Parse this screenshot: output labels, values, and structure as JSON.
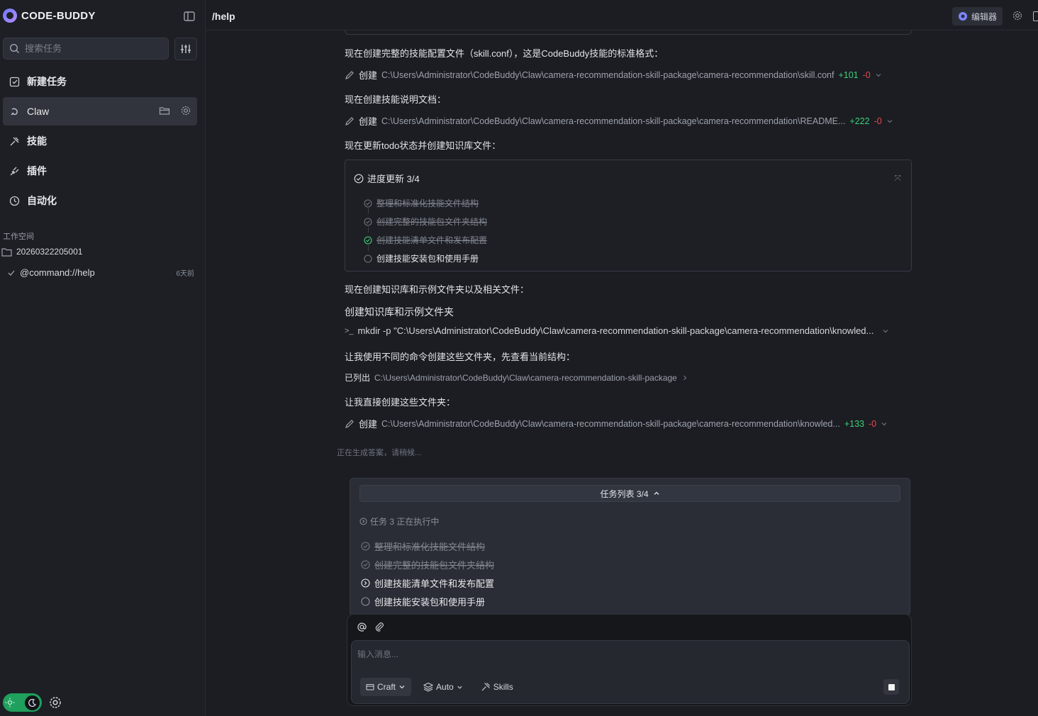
{
  "app": {
    "brand": "CODE-BUDDY",
    "accent_color": "#1fa05c",
    "brand_gradient": [
      "#6c7bff",
      "#b58cff"
    ]
  },
  "sidebar": {
    "search_placeholder": "搜索任务",
    "items": [
      {
        "label": "新建任务",
        "icon": "edit-square-icon"
      },
      {
        "label": "Claw",
        "icon": "claw-icon",
        "active": true
      },
      {
        "label": "技能",
        "icon": "skill-icon"
      },
      {
        "label": "插件",
        "icon": "plug-icon"
      },
      {
        "label": "自动化",
        "icon": "clock-icon"
      }
    ],
    "workspace_title": "工作空间",
    "workspace_folder": "20260322205001",
    "workspace_task": {
      "title": "@command://help",
      "time": "6天前"
    }
  },
  "topbar": {
    "path": "/help",
    "editor_label": "编辑器"
  },
  "conversation": {
    "messages": [
      {
        "type": "text",
        "text": "现在创建完整的技能配置文件（skill.conf），这是CodeBuddy技能的标准格式："
      },
      {
        "type": "tool",
        "verb": "创建",
        "path": "C:\\Users\\Administrator\\CodeBuddy\\Claw\\camera-recommendation-skill-package\\camera-recommendation\\skill.conf",
        "plus": "+101",
        "minus": "-0"
      },
      {
        "type": "text",
        "text": "现在创建技能说明文档："
      },
      {
        "type": "tool",
        "verb": "创建",
        "path": "C:\\Users\\Administrator\\CodeBuddy\\Claw\\camera-recommendation-skill-package\\camera-recommendation\\README...",
        "plus": "+222",
        "minus": "-0"
      },
      {
        "type": "text",
        "text": "现在更新todo状态并创建知识库文件："
      },
      {
        "type": "text",
        "text": "现在创建知识库和示例文件夹以及相关文件："
      },
      {
        "type": "text",
        "text": "创建知识库和示例文件夹"
      },
      {
        "type": "command",
        "prompt": ">_",
        "text": "mkdir -p \"C:\\Users\\Administrator\\CodeBuddy\\Claw\\camera-recommendation-skill-package\\camera-recommendation\\knowled..."
      },
      {
        "type": "text",
        "text": "让我使用不同的命令创建这些文件夹，先查看当前结构："
      },
      {
        "type": "list",
        "verb": "已列出",
        "path": "C:\\Users\\Administrator\\CodeBuddy\\Claw\\camera-recommendation-skill-package"
      },
      {
        "type": "text",
        "text": "让我直接创建这些文件夹："
      },
      {
        "type": "tool",
        "verb": "创建",
        "path": "C:\\Users\\Administrator\\CodeBuddy\\Claw\\camera-recommendation-skill-package\\camera-recommendation\\knowled...",
        "plus": "+133",
        "minus": "-0"
      }
    ],
    "progress": {
      "title": "进度更新 3/4",
      "todos": [
        {
          "text": "整理和标准化技能文件结构",
          "status": "done"
        },
        {
          "text": "创建完整的技能包文件夹结构",
          "status": "done"
        },
        {
          "text": "创建技能清单文件和发布配置",
          "status": "done"
        },
        {
          "text": "创建技能安装包和使用手册",
          "status": "pending"
        }
      ]
    },
    "generating_text": "正在生成答案，请稍候..."
  },
  "task_panel": {
    "header": "任务列表 3/4",
    "running": "任务 3 正在执行中",
    "todos": [
      {
        "text": "整理和标准化技能文件结构",
        "status": "done"
      },
      {
        "text": "创建完整的技能包文件夹结构",
        "status": "done"
      },
      {
        "text": "创建技能清单文件和发布配置",
        "status": "running"
      },
      {
        "text": "创建技能安装包和使用手册",
        "status": "pending"
      }
    ]
  },
  "composer": {
    "placeholder": "输入消息...",
    "mode": "Craft",
    "model": "Auto",
    "skills": "Skills"
  }
}
